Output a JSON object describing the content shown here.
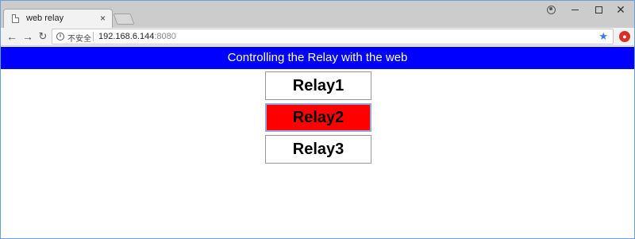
{
  "browser": {
    "tab_title": "web relay",
    "tab_close": "×",
    "address_security": "不安全",
    "url_host": "192.168.6.144",
    "url_port": ":8080",
    "window_close": "✕"
  },
  "page": {
    "banner_text": "Controlling the Relay with the web",
    "banner_color": "#0000ff",
    "relays": [
      {
        "label": "Relay1",
        "state": "off",
        "color": "#ffffff"
      },
      {
        "label": "Relay2",
        "state": "on",
        "color": "#ff0000"
      },
      {
        "label": "Relay3",
        "state": "off",
        "color": "#ffffff"
      }
    ]
  }
}
